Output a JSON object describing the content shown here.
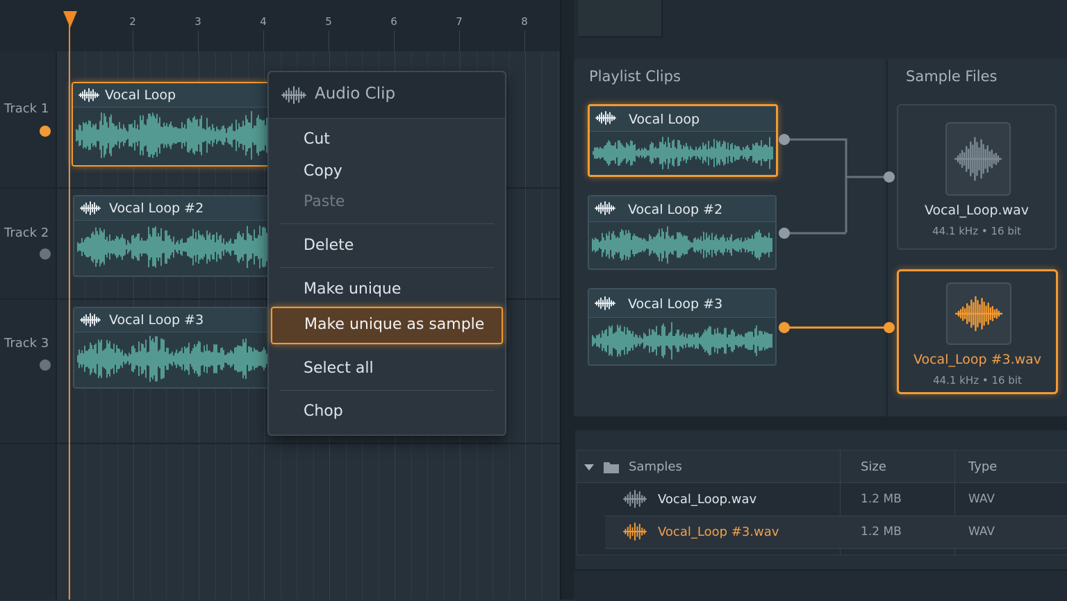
{
  "colors": {
    "accent": "#f39a33",
    "wave": "#5fb3a6",
    "wave_grey": "#7d8a94"
  },
  "ruler": {
    "ticks": [
      "2",
      "3",
      "4",
      "5",
      "6",
      "7",
      "8"
    ]
  },
  "tracks": [
    {
      "label": "Track 1",
      "active": true
    },
    {
      "label": "Track 2",
      "active": false
    },
    {
      "label": "Track 3",
      "active": false
    }
  ],
  "playlist_clips": [
    {
      "title": "Vocal Loop",
      "icon": "waveform-icon",
      "selected": true
    },
    {
      "title": "Vocal Loop #2",
      "icon": "waveform-icon",
      "selected": false
    },
    {
      "title": "Vocal Loop #3",
      "icon": "waveform-icon",
      "selected": false
    }
  ],
  "context_menu": {
    "title": "Audio Clip",
    "icon": "waveform-icon",
    "items": {
      "cut": "Cut",
      "copy": "Copy",
      "paste": "Paste",
      "delete": "Delete",
      "make_unique": "Make unique",
      "make_unique_as_sample": "Make unique as sample",
      "select_all": "Select all",
      "chop": "Chop"
    },
    "disabled": [
      "Paste"
    ],
    "highlighted": "Make unique as sample"
  },
  "clips_panel": {
    "title": "Playlist Clips",
    "clips": [
      {
        "title": "Vocal Loop",
        "selected": true
      },
      {
        "title": "Vocal Loop #2",
        "selected": false
      },
      {
        "title": "Vocal Loop #3",
        "selected": false
      }
    ]
  },
  "samples_panel": {
    "title": "Sample Files",
    "samples": [
      {
        "name": "Vocal_Loop.wav",
        "info": "44.1 kHz  •  16 bit",
        "selected": false,
        "icon": "waveform-icon"
      },
      {
        "name": "Vocal_Loop #3.wav",
        "info": "44.1 kHz  •  16 bit",
        "selected": true,
        "icon": "waveform-icon"
      }
    ]
  },
  "browser": {
    "folder": "Samples",
    "columns": {
      "name": "Samples",
      "size": "Size",
      "type": "Type"
    },
    "rows": [
      {
        "name": "Vocal_Loop.wav",
        "size": "1.2 MB",
        "type": "WAV",
        "selected": false
      },
      {
        "name": "Vocal_Loop #3.wav",
        "size": "1.2 MB",
        "type": "WAV",
        "selected": true
      }
    ]
  }
}
